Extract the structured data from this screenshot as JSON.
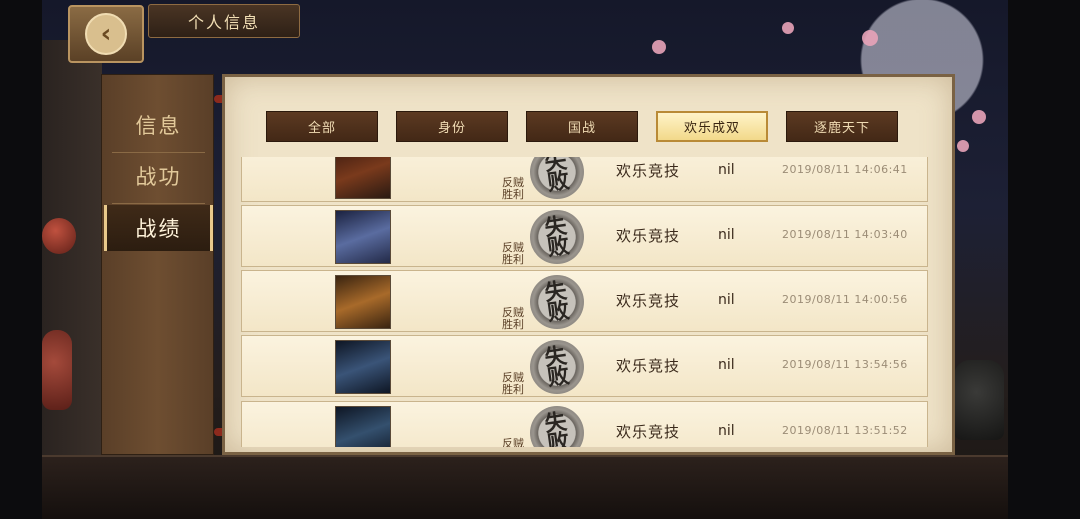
{
  "header": {
    "title": "个人信息",
    "back_icon": "back-arrow-icon"
  },
  "nav": {
    "items": [
      {
        "label": "信息",
        "active": false
      },
      {
        "label": "战功",
        "active": false
      },
      {
        "label": "战绩",
        "active": true
      }
    ]
  },
  "tabs": [
    {
      "label": "全部",
      "active": false
    },
    {
      "label": "身份",
      "active": false
    },
    {
      "label": "国战",
      "active": false
    },
    {
      "label": "欢乐成双",
      "active": true
    },
    {
      "label": "逐鹿天下",
      "active": false
    }
  ],
  "records": [
    {
      "role": "反贼",
      "result": "胜利",
      "stamp": "失败",
      "mode": "欢乐竞技",
      "value": "nil",
      "time": "2019/08/11  14:06:41",
      "avatar_color": "#7a3a1c"
    },
    {
      "role": "反贼",
      "result": "胜利",
      "stamp": "失败",
      "mode": "欢乐竞技",
      "value": "nil",
      "time": "2019/08/11  14:03:40",
      "avatar_color": "#4b5a8c"
    },
    {
      "role": "反贼",
      "result": "胜利",
      "stamp": "失败",
      "mode": "欢乐竞技",
      "value": "nil",
      "time": "2019/08/11  14:00:56",
      "avatar_color": "#8a5a24"
    },
    {
      "role": "反贼",
      "result": "胜利",
      "stamp": "失败",
      "mode": "欢乐竞技",
      "value": "nil",
      "time": "2019/08/11  13:54:56",
      "avatar_color": "#243450"
    },
    {
      "role": "反贼",
      "result": "胜利",
      "stamp": "失败",
      "mode": "欢乐竞技",
      "value": "nil",
      "time": "2019/08/11  13:51:52",
      "avatar_color": "#223048"
    }
  ]
}
